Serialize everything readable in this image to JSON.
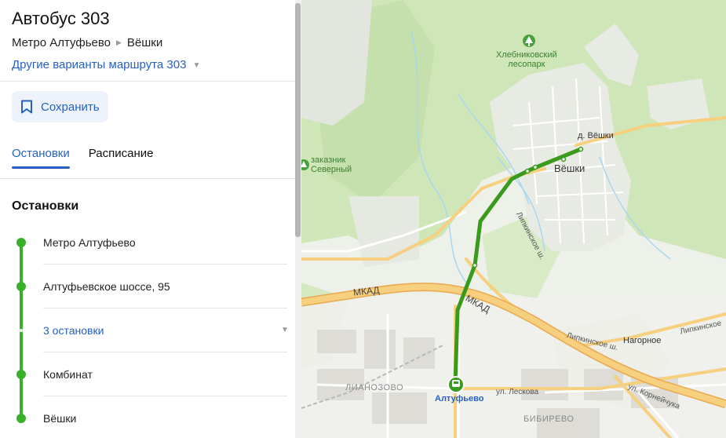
{
  "panel": {
    "title": "Автобус 303",
    "route_from": "Метро Алтуфьево",
    "route_to": "Вёшки",
    "route_variants_label": "Другие варианты маршрута 303",
    "save_label": "Сохранить",
    "tabs": [
      {
        "label": "Остановки",
        "active": true
      },
      {
        "label": "Расписание",
        "active": false
      }
    ],
    "stops_title": "Остановки",
    "stops": [
      {
        "label": "Метро Алтуфьево"
      },
      {
        "label": "Алтуфьевское шоссе, 95"
      },
      {
        "label": "3 остановки"
      },
      {
        "label": "Комбинат"
      },
      {
        "label": "Вёшки"
      }
    ]
  },
  "map": {
    "labels": {
      "park": "Хлебниковский\nлесопарк",
      "reserve": "заказник\nСеверный",
      "village_d": "д. Вёшки",
      "village": "Вёшки",
      "mkad_left": "МКАД",
      "mkad_right": "МКАД",
      "lipkinskoe_1": "Липкинское ш.",
      "lipkinskoe_2": "Липкинское ш.",
      "lipkinskoe_3": "Липкинское",
      "nagornoe": "Нагорное",
      "lianozovo": "ЛИАНОЗОВО",
      "bibirevo": "БИБИРЕВО",
      "leskova": "ул. Лескова",
      "korneychuka": "ул. Корнейчука",
      "station": "Алтуфьево"
    },
    "colors": {
      "route": "#3a9a1c",
      "forest": "#cfe6b8",
      "road": "#f6cf7f",
      "water": "#a9d7ef"
    }
  }
}
